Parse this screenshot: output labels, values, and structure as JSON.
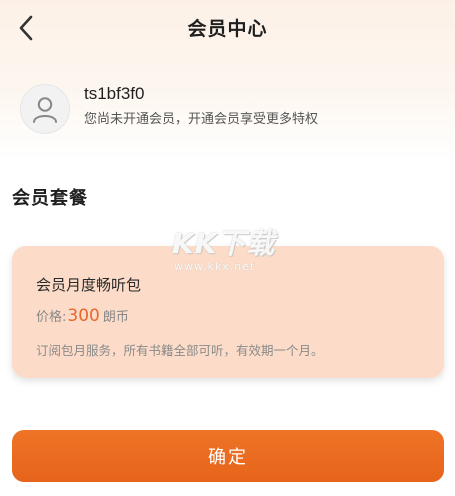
{
  "header": {
    "title": "会员中心",
    "back_icon": "chevron-left-icon"
  },
  "user": {
    "avatar_icon": "user-avatar-icon",
    "username": "ts1bf3f0",
    "hint": "您尚未开通会员，开通会员享受更多特权"
  },
  "section": {
    "title": "会员套餐"
  },
  "watermark": {
    "logo": "KK下载",
    "url": "www.kkx.net"
  },
  "plan": {
    "name": "会员月度畅听包",
    "price_label": "价格:",
    "price_value": "300",
    "price_unit": "朗币",
    "description": "订阅包月服务，所有书籍全部可听，有效期一个月。"
  },
  "actions": {
    "confirm_label": "确定"
  },
  "colors": {
    "accent": "#e8672a",
    "card_bg": "#fcdcc8",
    "button_bg": "#e96b20"
  }
}
